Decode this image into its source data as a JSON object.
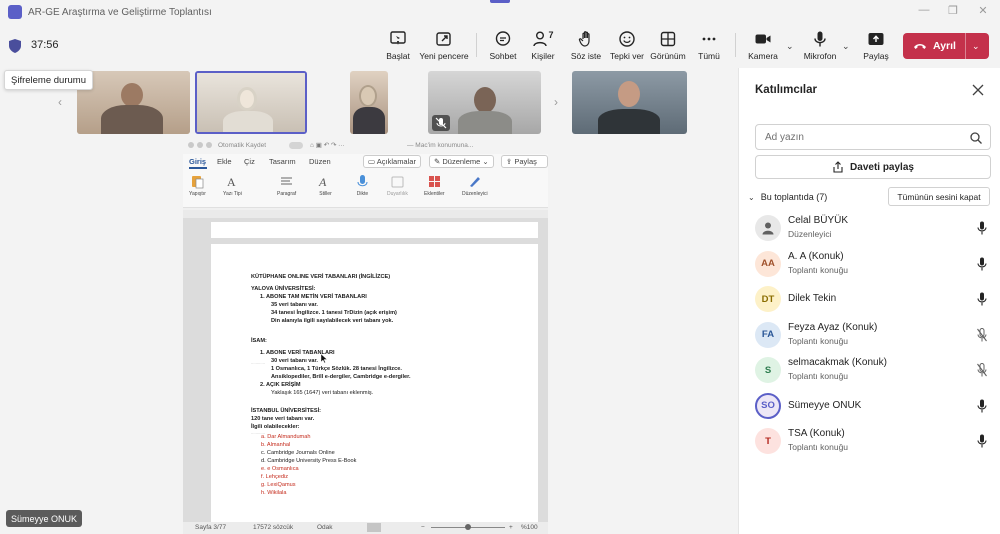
{
  "window": {
    "title": "AR-GE Araştırma ve Geliştirme Toplantısı"
  },
  "toolbar": {
    "timer": "37:56",
    "buttons": {
      "start": "Başlat",
      "new_window": "Yeni pencere",
      "chat": "Sohbet",
      "people": "Kişiler",
      "people_count": "7",
      "raise_hand": "Söz iste",
      "react": "Tepki ver",
      "view": "Görünüm",
      "more": "Tümü",
      "camera": "Kamera",
      "mic": "Mikrofon",
      "share": "Paylaş",
      "leave": "Ayrıl"
    }
  },
  "tooltip": "Şifreleme durumu",
  "presenter_badge": "Sümeyye ONUK",
  "word": {
    "autosave": "Otomatik Kaydet",
    "filename": "— Mac'im konumuna...",
    "tabs": [
      "Giriş",
      "Ekle",
      "Çiz",
      "Tasarım",
      "Düzen"
    ],
    "comments": "Açıklamalar",
    "editing": "Düzenleme",
    "share": "Paylaş",
    "ribbon": [
      "Yapıştır",
      "Yazı Tipi",
      "Paragraf",
      "Stiller",
      "Dikte",
      "Duyarlılık",
      "Eklentiler",
      "Düzenleyici"
    ],
    "status": {
      "page": "Sayfa 3/77",
      "words": "17572 sözcük",
      "focus": "Odak",
      "zoom": "%100"
    },
    "lines": [
      {
        "t": "KÜTÜPHANE ONLINE VERİ TABANLARI (İNGİLİZCE)",
        "s": "b",
        "x": 0
      },
      {
        "t": "YALOVA ÜNİVERSİTESİ:",
        "s": "b",
        "x": 0
      },
      {
        "t": "1.   ABONE TAM METİN VERİ TABANLARI",
        "s": "b",
        "x": 9
      },
      {
        "t": "35 veri tabanı var.",
        "s": "b",
        "x": 20
      },
      {
        "t": "34 tanesi İngilizce. 1 tanesi TrDizin (açık erişim)",
        "s": "b",
        "x": 20
      },
      {
        "t": "Din alanıyla ilgili sayılabilecek veri tabanı yok.",
        "s": "b",
        "x": 20
      },
      {
        "t": "İSAM:",
        "s": "b",
        "x": 0
      },
      {
        "t": "1.   ABONE VERİ TABANLARI",
        "s": "b",
        "x": 9
      },
      {
        "t": "30 veri tabanı var.",
        "s": "b",
        "x": 20
      },
      {
        "t": "1 Osmanlıca, 1 Türkçe Sözlük. 28 tanesi İngilizce.",
        "s": "b",
        "x": 20
      },
      {
        "t": "Ansiklopediler, Brill e-dergiler, Cambridge e-dergiler.",
        "s": "b",
        "x": 20
      },
      {
        "t": "2.   AÇIK ERİŞİM",
        "s": "b",
        "x": 9
      },
      {
        "t": "Yaklaşık 165 (1647) veri tabanı eklenmiş.",
        "s": "n",
        "x": 20
      },
      {
        "t": "İSTANBUL ÜNİVERSİTESİ:",
        "s": "b",
        "x": 0
      },
      {
        "t": "120 tane veri tabanı var.",
        "s": "b",
        "x": 0
      },
      {
        "t": "İlgili olabilecekler:",
        "s": "b",
        "x": 0
      },
      {
        "t": "a.   Dar Almandumah",
        "s": "r",
        "x": 10
      },
      {
        "t": "b.   Almanhal",
        "s": "r",
        "x": 10
      },
      {
        "t": "c.   Cambridge Journals Online",
        "s": "n",
        "x": 10
      },
      {
        "t": "d.   Cambridge University Press E-Book",
        "s": "n",
        "x": 10
      },
      {
        "t": "e.   e Osmanlıca",
        "s": "r",
        "x": 10
      },
      {
        "t": "f.   Lehçediz",
        "s": "r",
        "x": 10
      },
      {
        "t": "g.   LexiQamus",
        "s": "r",
        "x": 10
      },
      {
        "t": "h.   Wikilala",
        "s": "r",
        "x": 10
      }
    ]
  },
  "panel": {
    "title": "Katılımcılar",
    "search_placeholder": "Ad yazın",
    "share_invite": "Daveti paylaş",
    "section": "Bu toplantıda (7)",
    "mute_all": "Tümünün sesini kapat",
    "participants": [
      {
        "initials": "",
        "name": "Celal BÜYÜK",
        "role": "Düzenleyici",
        "bg": "#e8e8e8",
        "fg": "#616161",
        "mic": "on"
      },
      {
        "initials": "AA",
        "name": "A. A (Konuk)",
        "role": "Toplantı konuğu",
        "bg": "#fde6d8",
        "fg": "#a0522d",
        "mic": "on"
      },
      {
        "initials": "DT",
        "name": "Dilek Tekin",
        "role": "",
        "bg": "#fdf1c8",
        "fg": "#8a6d00",
        "mic": "on"
      },
      {
        "initials": "FA",
        "name": "Feyza Ayaz (Konuk)",
        "role": "Toplantı konuğu",
        "bg": "#dce8f5",
        "fg": "#2b5797",
        "mic": "off"
      },
      {
        "initials": "S",
        "name": "selmacakmak (Konuk)",
        "role": "Toplantı konuğu",
        "bg": "#dff3e4",
        "fg": "#2e7d4f",
        "mic": "off"
      },
      {
        "initials": "SO",
        "name": "Sümeyye ONUK",
        "role": "",
        "bg": "#ede7f6",
        "fg": "#5b5fc7",
        "mic": "on"
      },
      {
        "initials": "T",
        "name": "TSA (Konuk)",
        "role": "Toplantı konuğu",
        "bg": "#fde2df",
        "fg": "#b3261e",
        "mic": "on"
      }
    ]
  }
}
